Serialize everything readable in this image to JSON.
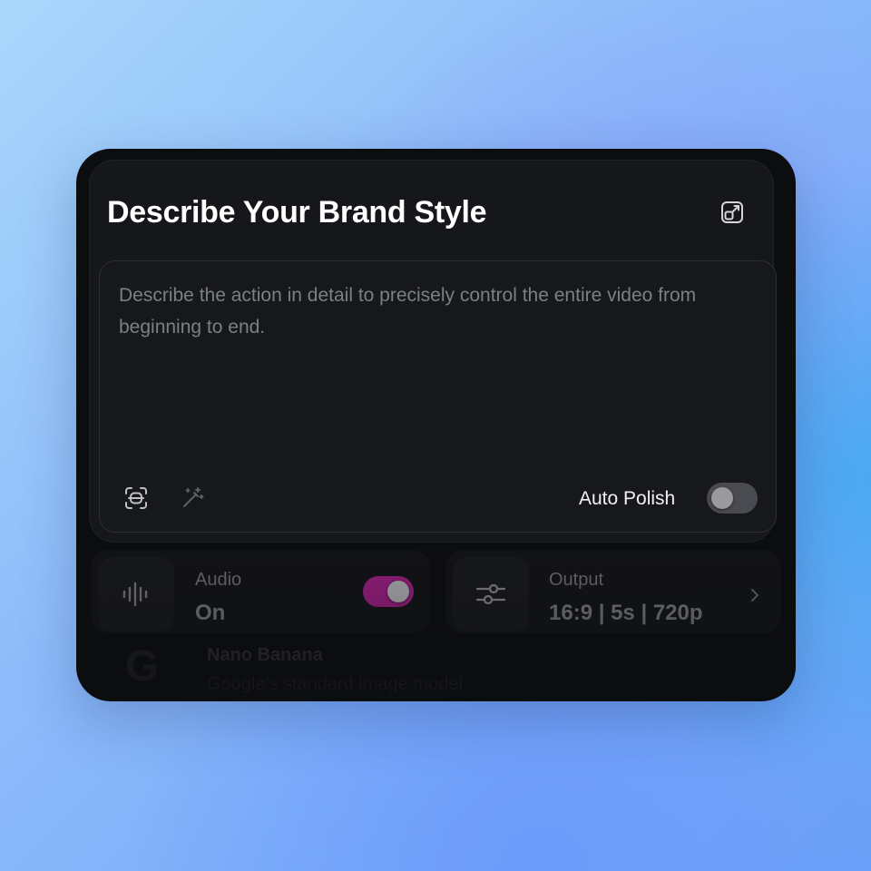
{
  "panel": {
    "title": "Describe Your Brand Style",
    "expand_icon": "expand-icon"
  },
  "prompt": {
    "placeholder": "Describe the action in detail to precisely control the entire video from beginning to end.",
    "value": "",
    "tools": [
      {
        "icon": "scan-text-icon"
      },
      {
        "icon": "magic-wand-icon"
      }
    ],
    "auto_polish": {
      "label": "Auto Polish",
      "enabled": false
    }
  },
  "audio": {
    "icon": "audio-waveform-icon",
    "label": "Audio",
    "value": "On",
    "enabled": true
  },
  "output": {
    "icon": "sliders-icon",
    "label": "Output",
    "value": "16:9 | 5s | 720p"
  },
  "model": {
    "logo": "G",
    "name": "Nano Banana",
    "description": "Google's standard image model"
  },
  "colors": {
    "card_bg": "#0c0d0f",
    "panel_bg": "#16171a",
    "toggle_on": "#8d1d78",
    "toggle_off": "#4a4b50",
    "text_primary": "#ffffff",
    "placeholder": "#7d7f86"
  }
}
